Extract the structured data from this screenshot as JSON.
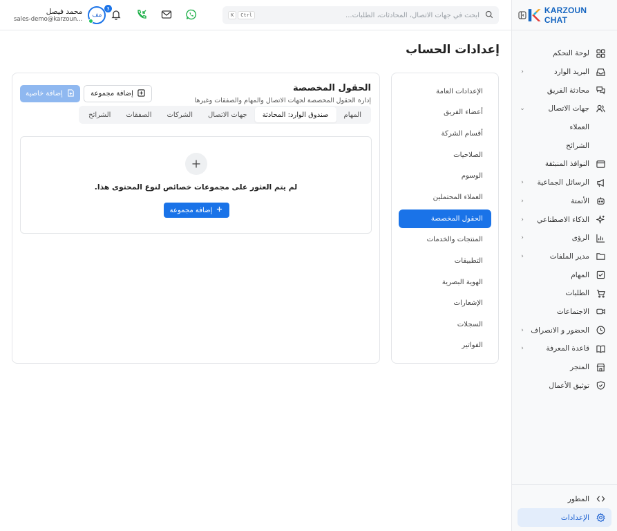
{
  "brand": {
    "name": "KARZOUN CHAT"
  },
  "topbar": {
    "search_placeholder": "ابحث في جهات الاتصال، المحادثات، الطلبات...",
    "shortcut_keys": [
      "Ctrl",
      "K"
    ],
    "notification_count": "3",
    "user": {
      "initials": "مف",
      "name": "محمد فيصل",
      "email": "sales-demo@karzoun..."
    }
  },
  "page": {
    "title": "إعدادات الحساب"
  },
  "sidebar": {
    "items": [
      {
        "label": "لوحة التحكم",
        "icon": "dashboard-icon",
        "chevron": false
      },
      {
        "label": "البريد الوارد",
        "icon": "inbox-icon",
        "chevron": true
      },
      {
        "label": "محادثة الفريق",
        "icon": "chat-icon",
        "chevron": false
      },
      {
        "label": "جهات الاتصال",
        "icon": "users-icon",
        "chevron": true,
        "expanded": true
      },
      {
        "label": "العملاء",
        "sub": true
      },
      {
        "label": "الشرائح",
        "sub": true
      },
      {
        "label": "النوافذ المنبثقة",
        "icon": "window-icon",
        "chevron": false
      },
      {
        "label": "الرسائل الجماعية",
        "icon": "megaphone-icon",
        "chevron": true
      },
      {
        "label": "الأتمتة",
        "icon": "bot-icon",
        "chevron": true
      },
      {
        "label": "الذكاء الاصطناعي",
        "icon": "sparkle-icon",
        "chevron": true
      },
      {
        "label": "الرؤى",
        "icon": "chart-icon",
        "chevron": true
      },
      {
        "label": "مدير الملفات",
        "icon": "folder-icon",
        "chevron": true
      },
      {
        "label": "المهام",
        "icon": "checkbox-icon",
        "chevron": false
      },
      {
        "label": "الطلبات",
        "icon": "cart-icon",
        "chevron": false
      },
      {
        "label": "الاجتماعات",
        "icon": "video-icon",
        "chevron": false
      },
      {
        "label": "الحضور و الانصراف",
        "icon": "clock-icon",
        "chevron": true
      },
      {
        "label": "قاعدة المعرفة",
        "icon": "book-icon",
        "chevron": true
      },
      {
        "label": "المتجر",
        "icon": "store-icon",
        "chevron": false
      },
      {
        "label": "توثيق الأعمال",
        "icon": "shield-icon",
        "chevron": false
      }
    ],
    "bottom": [
      {
        "label": "المطور",
        "icon": "code-icon"
      },
      {
        "label": "الإعدادات",
        "icon": "gear-icon",
        "active": true
      }
    ]
  },
  "settings_nav": {
    "items": [
      "الإعدادات العامة",
      "أعضاء الفريق",
      "أقسام الشركة",
      "الصلاحيات",
      "الوسوم",
      "العملاء المحتملين",
      "الحقول المخصصة",
      "المنتجات والخدمات",
      "التطبيقات",
      "الهوية البصرية",
      "الإشعارات",
      "السجلات",
      "الفواتير"
    ],
    "active": "الحقول المخصصة"
  },
  "panel": {
    "title": "الحقول المخصصة",
    "description": "إدارة الحقول المخصصة لجهات الاتصال والمهام والصفقات وغيرها",
    "add_group_label": "إضافة مجموعة",
    "add_property_label": "إضافة خاصية",
    "tabs": [
      "المهام",
      "صندوق الوارد: المحادثة",
      "جهات الاتصال",
      "الشركات",
      "الصفقات",
      "الشرائح"
    ],
    "active_tab": "صندوق الوارد: المحادثة",
    "empty_text": "لم يتم العثور على مجموعات خصائص لنوع المحتوى هذا.",
    "empty_add_label": "إضافة مجموعة"
  }
}
